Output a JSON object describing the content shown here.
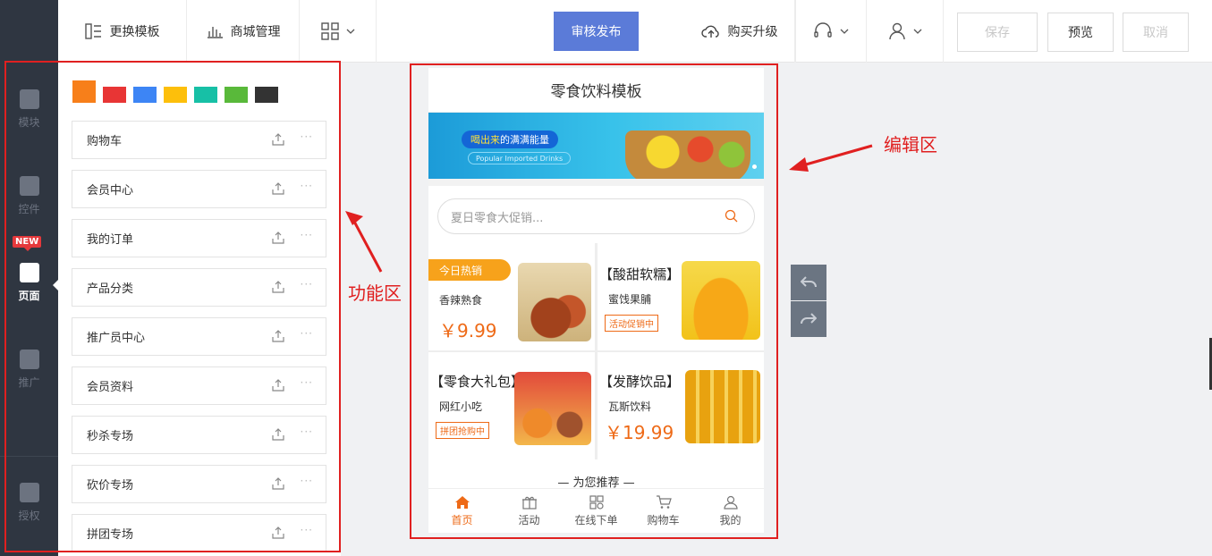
{
  "rail": {
    "items": [
      {
        "label": "模块",
        "icon": "module-icon"
      },
      {
        "label": "控件",
        "icon": "widget-icon"
      },
      {
        "label": "页面",
        "icon": "page-icon"
      },
      {
        "label": "推广",
        "icon": "megaphone-icon"
      },
      {
        "label": "授权",
        "icon": "shield-check-icon"
      }
    ],
    "badge": "NEW",
    "active": "页面"
  },
  "toolbar": {
    "change_template": "更换模板",
    "mall_manage": "商城管理",
    "review_publish": "审核发布",
    "buy_upgrade": "购买升级",
    "save": "保存",
    "preview": "预览",
    "cancel": "取消"
  },
  "colors": {
    "swatches": [
      "#f77f1a",
      "#e83535",
      "#3d85f5",
      "#fdbf0b",
      "#17c0a6",
      "#59b93a",
      "#333333"
    ],
    "accent": "#ee6a17",
    "primary_button": "#5b7bd8",
    "annotation": "#e02020"
  },
  "func_items": [
    "购物车",
    "会员中心",
    "我的订单",
    "产品分类",
    "推广员中心",
    "会员资料",
    "秒杀专场",
    "砍价专场",
    "拼团专场"
  ],
  "annotations": {
    "function_area": "功能区",
    "edit_area": "编辑区"
  },
  "phone": {
    "title": "零食饮料模板",
    "banner": {
      "pill_highlight": "喝出来",
      "pill_rest": "的满满能量",
      "sub": "Popular Imported Drinks"
    },
    "search_placeholder": "夏日零食大促销...",
    "cells": [
      {
        "badge": "今日热销",
        "name": "香辣熟食",
        "price": "￥9.99"
      },
      {
        "title": "【酸甜软糯】",
        "name": "蜜饯果脯",
        "tag": "活动促销中"
      },
      {
        "title": "【零食大礼包】",
        "name": "网红小吃",
        "tag": "拼团抢购中"
      },
      {
        "title": "【发酵饮品】",
        "name": "瓦斯饮料",
        "price": "￥19.99"
      }
    ],
    "recommend": "— 为您推荐 —",
    "tabs": [
      "首页",
      "活动",
      "在线下单",
      "购物车",
      "我的"
    ]
  }
}
